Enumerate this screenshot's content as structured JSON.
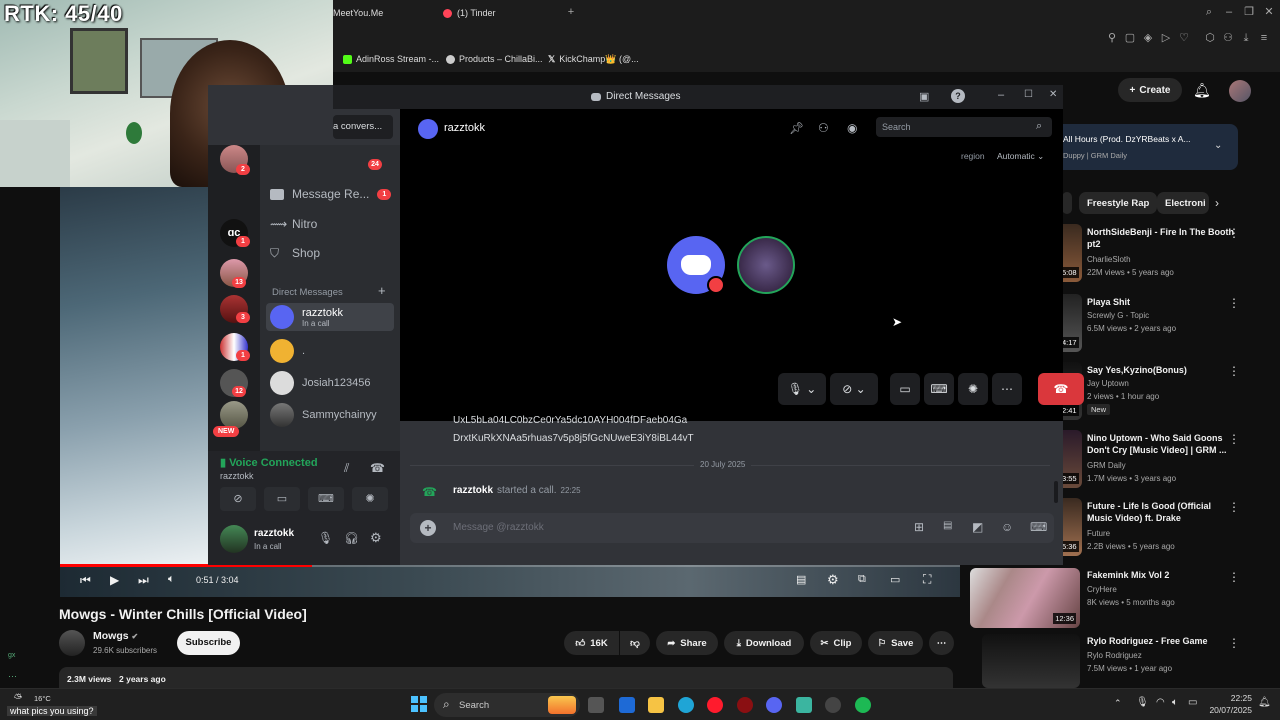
{
  "browser": {
    "tabs": [
      "MeetYou.Me",
      "(1) Tinder"
    ],
    "bookmarks": [
      "AdinRoss Stream -...",
      "Products – ChillaBi...",
      "KickChamp👑 (@..."
    ]
  },
  "youtube": {
    "create_label": "Create",
    "now_playing_title": "All Hours (Prod. DzYRBeats x A...",
    "now_playing_channel": "Duppy | GRM Daily",
    "chips": [
      "Freestyle Rap",
      "Electroni"
    ],
    "recommendations": [
      {
        "title": "NorthSideBenji - Fire In The Booth pt2",
        "channel": "CharlieSloth",
        "meta": "22M views • 5 years ago",
        "duration": "5:08"
      },
      {
        "title": "Playa Shit",
        "channel": "Screwly G - Topic",
        "meta": "6.5M views • 2 years ago",
        "duration": "4:17"
      },
      {
        "title": "Say Yes,Kyzino(Bonus)",
        "channel": "Jay Uptown",
        "meta": "2 views • 1 hour ago",
        "badge": "New",
        "duration": "2:41"
      },
      {
        "title": "Nino Uptown - Who Said Goons Don't Cry [Music Video] | GRM ...",
        "channel": "GRM Daily",
        "meta": "1.7M views • 3 years ago",
        "duration": "3:55"
      },
      {
        "title": "Future - Life Is Good (Official Music Video) ft. Drake",
        "channel": "Future",
        "meta": "2.2B views • 5 years ago",
        "duration": "5:36"
      },
      {
        "title": "Fakemink Mix Vol 2",
        "channel": "CryHere",
        "meta": "8K views • 5 months ago",
        "duration": "12:36"
      },
      {
        "title": "Rylo Rodriguez - Free Game",
        "channel": "Rylo Rodriguez",
        "meta": "7.5M views • 1 year ago",
        "duration": ""
      }
    ],
    "player": {
      "time": "0:51 / 3:04",
      "progress": 0.28
    },
    "video_title": "Mowgs - Winter Chills [Official Video]",
    "channel_name": "Mowgs",
    "subscribers": "29.6K subscribers",
    "subscribe_label": "Subscribe",
    "likes": "16K",
    "share_label": "Share",
    "download_label": "Download",
    "clip_label": "Clip",
    "save_label": "Save",
    "views": "2.3M views",
    "age": "2 years ago"
  },
  "webcam": {
    "overlay": "RTK: 45/40"
  },
  "discord": {
    "window_title": "Direct Messages",
    "start_convo": "a convers...",
    "friends_badge": "24",
    "side_items": [
      {
        "label": "Message Re...",
        "badge": "1"
      },
      {
        "label": "Nitro"
      },
      {
        "label": "Shop"
      }
    ],
    "dm_header": "Direct Messages",
    "dms": [
      {
        "name": "razztokk",
        "status": "In a call"
      },
      {
        "name": "."
      },
      {
        "name": "Josiah123456"
      },
      {
        "name": "Sammychainyy"
      }
    ],
    "server_badges": [
      "2",
      "1",
      "13",
      "3",
      "1",
      "12"
    ],
    "new_label": "NEW",
    "voice_connected": "Voice Connected",
    "voice_channel": "razztokk",
    "user_name": "razztokk",
    "user_status": "In a call",
    "call_header_name": "razztokk",
    "search_placeholder": "Search",
    "region_label": "region",
    "region_value": "Automatic",
    "chat": {
      "prev_line1": "UxL5bLa04LC0bzCe0rYa5dc10AYH004fDFaeb04Ga",
      "prev_line2": "DrxtKuRkXNAa5rhuas7v5p8j5fGcNUweE3iY8iBL44vT",
      "date_divider": "20 July 2025",
      "call_user": "razztokk",
      "call_text": "started a call.",
      "call_time": "22:25",
      "message_placeholder": "Message @razztokk"
    }
  },
  "taskbar": {
    "temp": "16°C",
    "ticker": "what pics you using?",
    "search": "Search",
    "time": "22:25",
    "date": "20/07/2025",
    "side_label": "gx"
  }
}
